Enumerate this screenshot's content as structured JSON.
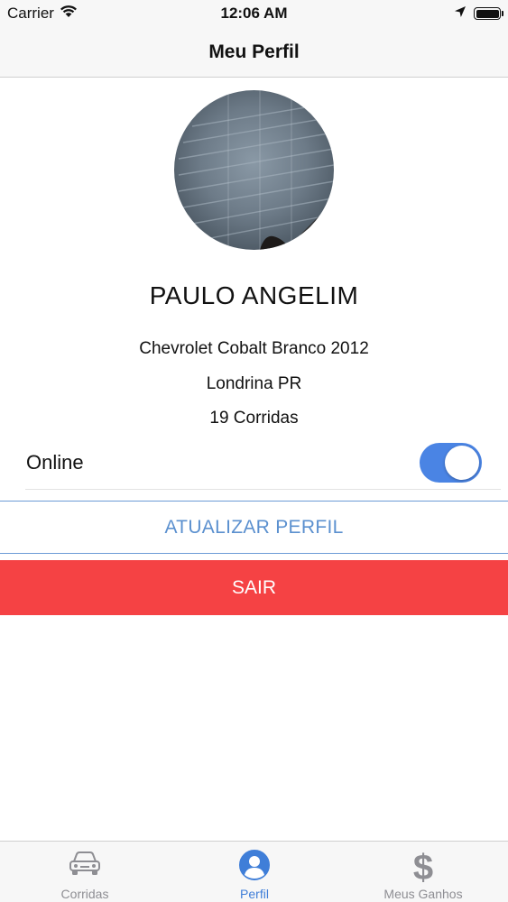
{
  "status_bar": {
    "carrier": "Carrier",
    "time": "12:06 AM",
    "battery_level": 1.0
  },
  "nav": {
    "title": "Meu Perfil"
  },
  "profile": {
    "name": "PAULO ANGELIM",
    "vehicle": "Chevrolet Cobalt Branco 2012",
    "city": "Londrina PR",
    "rides": "19 Corridas"
  },
  "online": {
    "label": "Online",
    "enabled": true,
    "color": "#4a84e4"
  },
  "actions": {
    "update_label": "ATUALIZAR PERFIL",
    "update_color": "#5b90cf",
    "logout_label": "SAIR",
    "logout_color": "#f54244"
  },
  "tabs": [
    {
      "label": "Corridas",
      "icon": "car-icon",
      "active": false
    },
    {
      "label": "Perfil",
      "icon": "profile-icon",
      "active": true
    },
    {
      "label": "Meus Ganhos",
      "icon": "dollar-icon",
      "active": false
    }
  ],
  "colors": {
    "active_tab": "#3f7ed8",
    "inactive_tab": "#8e8e93"
  }
}
